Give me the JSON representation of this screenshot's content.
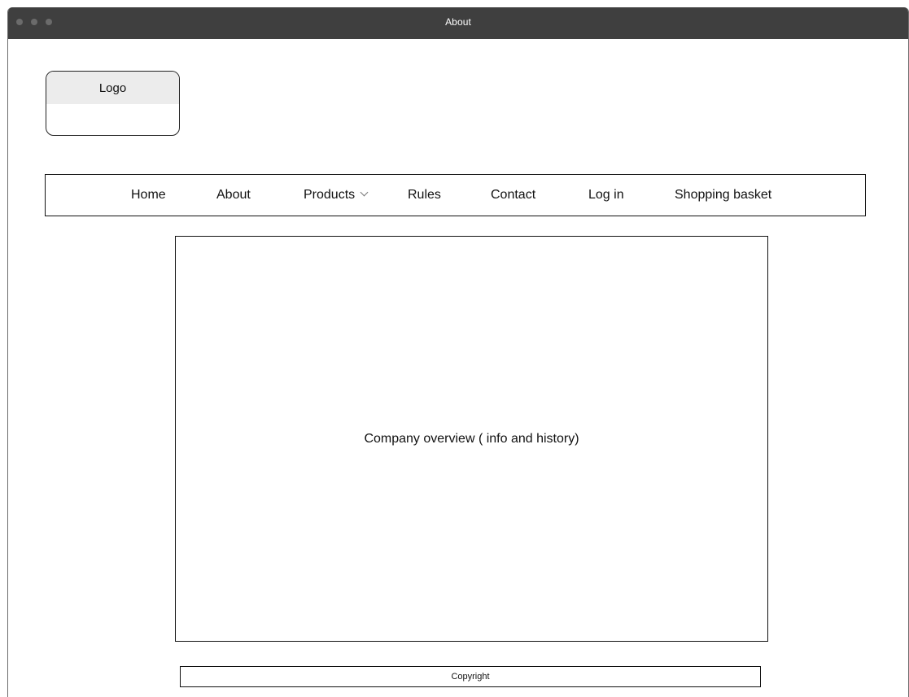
{
  "window": {
    "title": "About"
  },
  "logo": {
    "label": "Logo"
  },
  "nav": {
    "items": [
      {
        "label": "Home"
      },
      {
        "label": "About"
      },
      {
        "label": "Products",
        "icon": "chevron-down-icon"
      },
      {
        "label": "Rules"
      },
      {
        "label": "Contact"
      },
      {
        "label": "Log in"
      },
      {
        "label": "Shopping basket"
      }
    ]
  },
  "content": {
    "text": "Company overview ( info and history)"
  },
  "footer": {
    "text": "Copyright"
  }
}
